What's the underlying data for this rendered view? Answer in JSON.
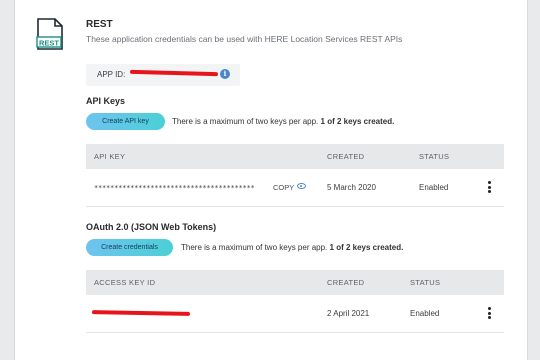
{
  "header": {
    "icon_label": "REST",
    "title": "REST",
    "subtitle": "These application credentials can be used with HERE Location Services REST APIs"
  },
  "app_id": {
    "label": "APP ID:"
  },
  "api_keys": {
    "title": "API Keys",
    "button": "Create API key",
    "note_prefix": "There is a maximum of two keys per app.",
    "note_bold": "1 of 2 keys created.",
    "columns": [
      "API KEY",
      "CREATED",
      "STATUS"
    ],
    "rows": [
      {
        "key": "****************************************",
        "copy": "COPY",
        "created": "5 March 2020",
        "status": "Enabled"
      }
    ]
  },
  "oauth": {
    "title": "OAuth 2.0 (JSON Web Tokens)",
    "button": "Create credentials",
    "note_prefix": "There is a maximum of two keys per app.",
    "note_bold": "1 of 2 keys created.",
    "columns": [
      "ACCESS KEY ID",
      "CREATED",
      "STATUS"
    ],
    "rows": [
      {
        "created": "2 April 2021",
        "status": "Enabled"
      }
    ]
  },
  "colors": {
    "accent_gradient_start": "#6ec3f0",
    "accent_gradient_end": "#4bd0d6",
    "redaction": "#e8141c",
    "icon_teal": "#1a8f86"
  }
}
